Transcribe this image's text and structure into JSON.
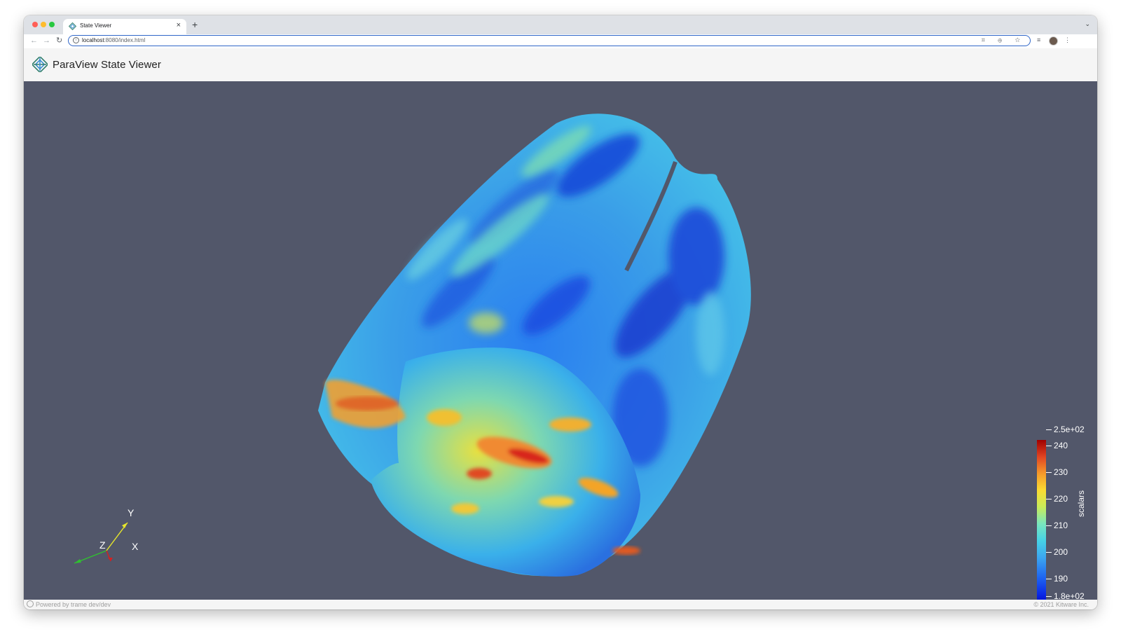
{
  "browser": {
    "tab_title": "State Viewer",
    "tab_close": "×",
    "new_tab": "+",
    "url_host": "localhost",
    "url_rest": ":8080/index.html",
    "address_icons": "⌗ ⊕ ☆"
  },
  "app": {
    "title": "ParaView State Viewer"
  },
  "colorbar": {
    "title": "scalars",
    "labels": [
      "2.5e+02",
      "240",
      "230",
      "220",
      "210",
      "200",
      "190",
      "1.8e+02"
    ]
  },
  "axes": {
    "x_label": "X",
    "y_label": "Y",
    "z_label": "Z",
    "x_color": "#d62020",
    "y_color": "#e6e62c",
    "z_color": "#30c030"
  },
  "footer": {
    "left": "Powered by trame dev/dev",
    "right": "© 2021 Kitware Inc."
  },
  "colors": {
    "viewport_bg": "#52576a",
    "header_bg": "#f5f5f5",
    "omnibox_border": "#2f66c8"
  }
}
